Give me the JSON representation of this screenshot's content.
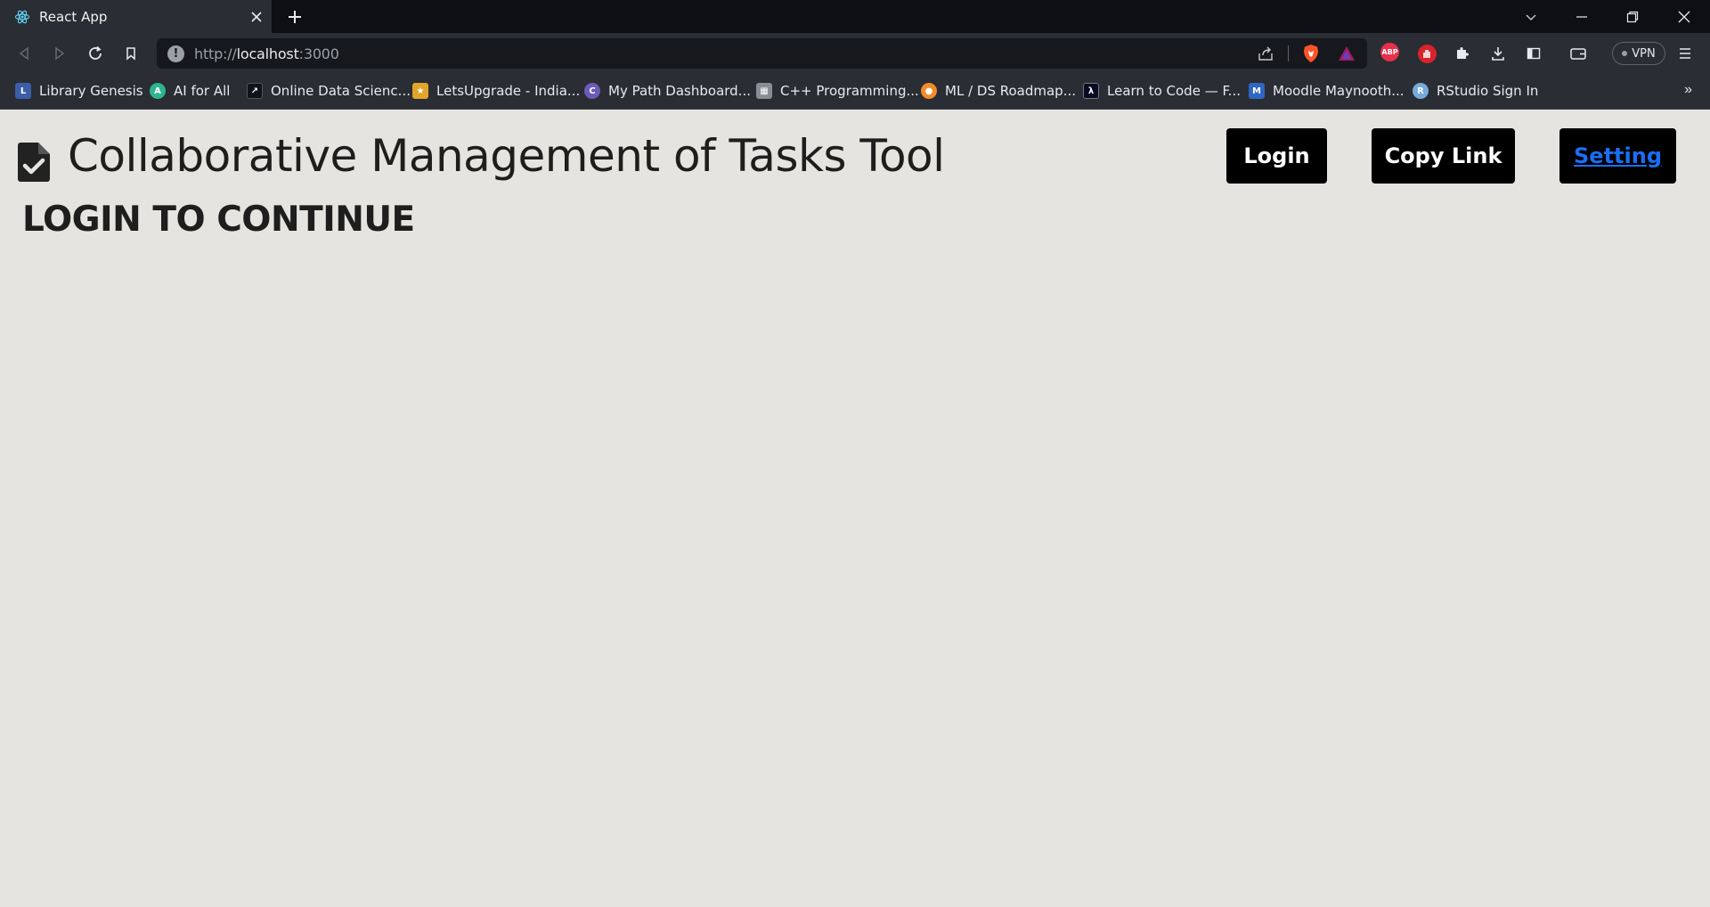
{
  "browser": {
    "tab": {
      "title": "React App",
      "favicon": "react-icon"
    },
    "address": {
      "scheme": "http://",
      "host": "localhost",
      "port": ":3000"
    },
    "vpn_label": "VPN",
    "abp_label": "ABP",
    "bookmarks": [
      {
        "label": "Library Genesis",
        "icon": "library-genesis-icon",
        "color": "#3a5fa8"
      },
      {
        "label": "AI for All",
        "icon": "ai-for-all-icon",
        "color": "#2fb58f"
      },
      {
        "label": "Online Data Scienc...",
        "icon": "data-science-icon",
        "color": "#10131a"
      },
      {
        "label": "LetsUpgrade - India...",
        "icon": "letsupgrade-icon",
        "color": "#e0a52a"
      },
      {
        "label": "My Path Dashboard...",
        "icon": "my-path-icon",
        "color": "#6c5bb8"
      },
      {
        "label": "C++ Programming...",
        "icon": "cpp-icon",
        "color": "#8a8d93"
      },
      {
        "label": "ML / DS Roadmap...",
        "icon": "roadmap-icon",
        "color": "#f28b2a"
      },
      {
        "label": "Learn to Code — F...",
        "icon": "freecodecamp-icon",
        "color": "#0a0a23"
      },
      {
        "label": "Moodle Maynooth...",
        "icon": "moodle-icon",
        "color": "#2f66c2"
      },
      {
        "label": "RStudio Sign In",
        "icon": "rstudio-icon",
        "color": "#75aadb"
      }
    ]
  },
  "app": {
    "title": "Collaborative Management of Tasks Tool",
    "logo_icon": "document-check-icon",
    "buttons": {
      "login": "Login",
      "copy_link": "Copy Link",
      "setting": "Setting"
    },
    "message": "LOGIN TO CONTINUE"
  },
  "colors": {
    "page_background": "#e5e4e0",
    "button_background": "#000000",
    "setting_link": "#1a6ef5",
    "chrome_dark": "#2a2d33"
  }
}
